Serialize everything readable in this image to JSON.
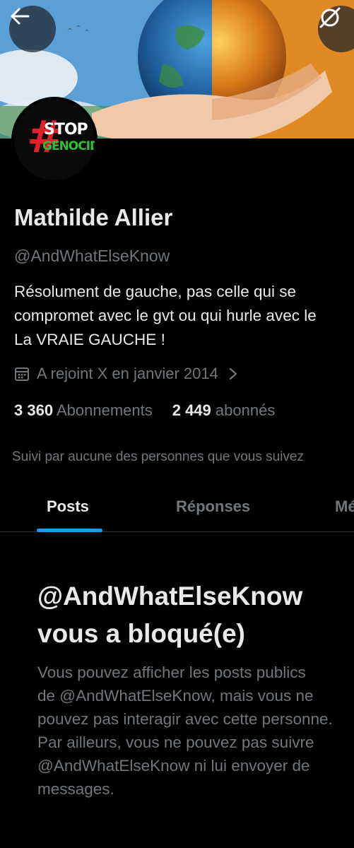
{
  "header": {
    "back_icon": "arrow-left-icon",
    "grok_icon": "grok-icon",
    "banner_description_colors": [
      "#2f6fb0",
      "#f0a030"
    ]
  },
  "avatar": {
    "logo_text_top": "STOP",
    "logo_text_bottom": "GENOCIDE",
    "logo_colors": [
      "#e0202a",
      "#2fbf3a"
    ]
  },
  "profile": {
    "name": "Mathilde Allier",
    "handle": "@AndWhatElseKnow",
    "bio_lines": [
      "Résolument de gauche, pas celle qui se",
      "compromet avec le gvt ou qui hurle avec le",
      "La VRAIE GAUCHE !"
    ],
    "joined": "A rejoint X en janvier 2014",
    "following_count": "3 360",
    "following_label": "Abonnements",
    "followers_count": "2 449",
    "followers_label": "abonnés",
    "followed_by": "Suivi par aucune des personnes que vous suivez"
  },
  "tabs": [
    {
      "label": "Posts",
      "active": true
    },
    {
      "label": "Réponses",
      "active": false
    },
    {
      "label": "Mé",
      "active": false
    }
  ],
  "blocked": {
    "title_lines": [
      "@AndWhatElseKnow",
      "vous a bloqué(e)"
    ],
    "text_lines": [
      "Vous pouvez afficher les posts publics",
      "de @AndWhatElseKnow, mais vous ne",
      "pouvez pas interagir avec cette personne.",
      "Par ailleurs, vous ne pouvez pas suivre",
      "@AndWhatElseKnow ni lui envoyer de",
      "messages."
    ]
  },
  "colors": {
    "background": "#000000",
    "primary_text": "#e7e9ea",
    "secondary_text": "#71767b",
    "accent": "#1d9bf0"
  }
}
